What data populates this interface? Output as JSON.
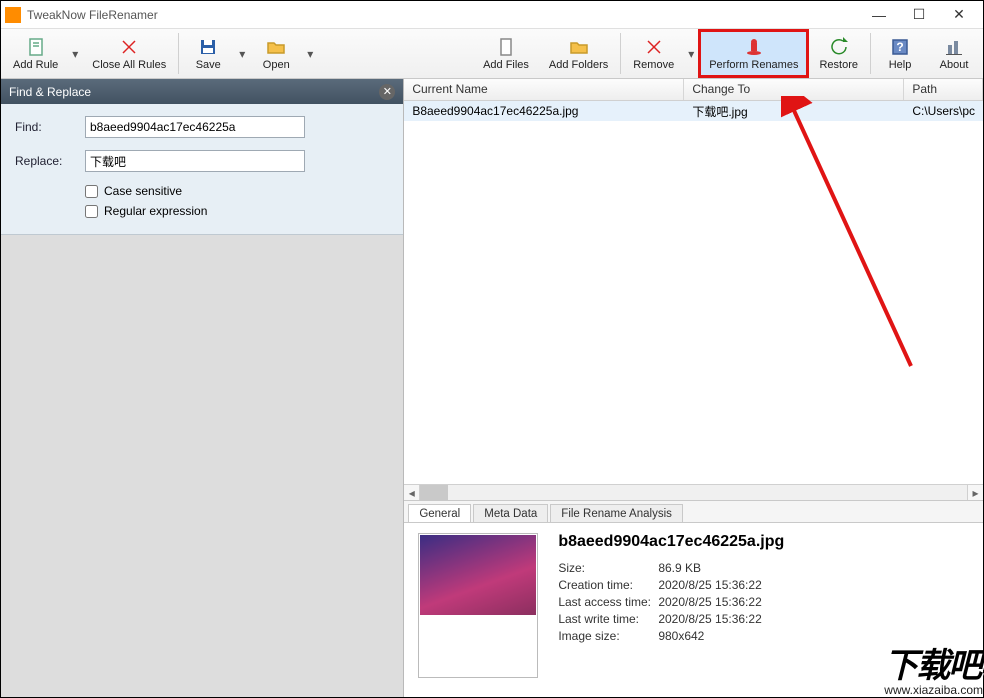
{
  "titlebar": {
    "title": "TweakNow FileRenamer"
  },
  "toolbar": {
    "left": {
      "add_rule": "Add Rule",
      "close_all_rules": "Close All Rules",
      "save": "Save",
      "open": "Open"
    },
    "right": {
      "add_files": "Add Files",
      "add_folders": "Add Folders",
      "remove": "Remove",
      "perform_renames": "Perform Renames",
      "restore": "Restore",
      "help": "Help",
      "about": "About"
    }
  },
  "panel": {
    "title": "Find & Replace",
    "find_label": "Find:",
    "find_value": "b8aeed9904ac17ec46225a",
    "replace_label": "Replace:",
    "replace_value": "下载吧",
    "case_sensitive": "Case sensitive",
    "regex": "Regular expression"
  },
  "list": {
    "cols": {
      "current_name": "Current Name",
      "change_to": "Change To",
      "path": "Path"
    },
    "row": {
      "current_name": "B8aeed9904ac17ec46225a.jpg",
      "change_to": "下载吧.jpg",
      "path": "C:\\Users\\pc"
    }
  },
  "tabs": {
    "general": "General",
    "meta": "Meta Data",
    "analysis": "File Rename Analysis"
  },
  "detail": {
    "filename": "b8aeed9904ac17ec46225a.jpg",
    "rows": {
      "size_k": "Size:",
      "size_v": "86.9 KB",
      "ctime_k": "Creation time:",
      "ctime_v": "2020/8/25 15:36:22",
      "atime_k": "Last access time:",
      "atime_v": "2020/8/25 15:36:22",
      "wtime_k": "Last write time:",
      "wtime_v": "2020/8/25 15:36:22",
      "isize_k": "Image size:",
      "isize_v": "980x642"
    }
  },
  "watermark": {
    "big": "下载吧",
    "url": "www.xiazaiba.com"
  }
}
